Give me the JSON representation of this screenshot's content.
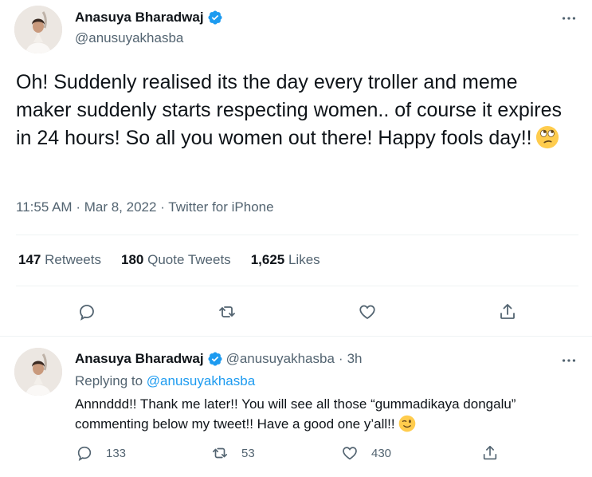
{
  "tweet": {
    "author": {
      "name": "Anasuya Bharadwaj",
      "handle": "@anusuyakhasba"
    },
    "text": "Oh! Suddenly realised its the day every troller and meme maker suddenly starts respecting women.. of course it expires in 24 hours! So all you women out there! Happy fools day!!",
    "emoji": "face-with-rolling-eyes",
    "time": "11:55 AM",
    "date": "Mar 8, 2022",
    "source": "Twitter for iPhone",
    "sep": "·",
    "stats": {
      "retweets_count": "147",
      "retweets_label": "Retweets",
      "quotes_count": "180",
      "quotes_label": "Quote Tweets",
      "likes_count": "1,625",
      "likes_label": "Likes"
    }
  },
  "reply": {
    "author": {
      "name": "Anasuya Bharadwaj",
      "handle": "@anusuyakhasba"
    },
    "time_ago": "3h",
    "sep": "·",
    "replying_prefix": "Replying to",
    "replying_to": "@anusuyakhasba",
    "text": "Annnddd!! Thank me later!! You will see all those “gummadikaya dongalu” commenting below my tweet!! Have a good one y’all!!",
    "emoji": "winking-face",
    "counts": {
      "replies": "133",
      "retweets": "53",
      "likes": "430"
    }
  },
  "icons": {
    "more": "more-icon",
    "reply": "reply-icon",
    "retweet": "retweet-icon",
    "like": "like-icon",
    "share": "share-icon",
    "verified": "verified-badge-icon"
  },
  "colors": {
    "accent": "#1d9bf0",
    "text": "#0f1419",
    "secondary": "#536471",
    "divider": "#eff3f4"
  }
}
